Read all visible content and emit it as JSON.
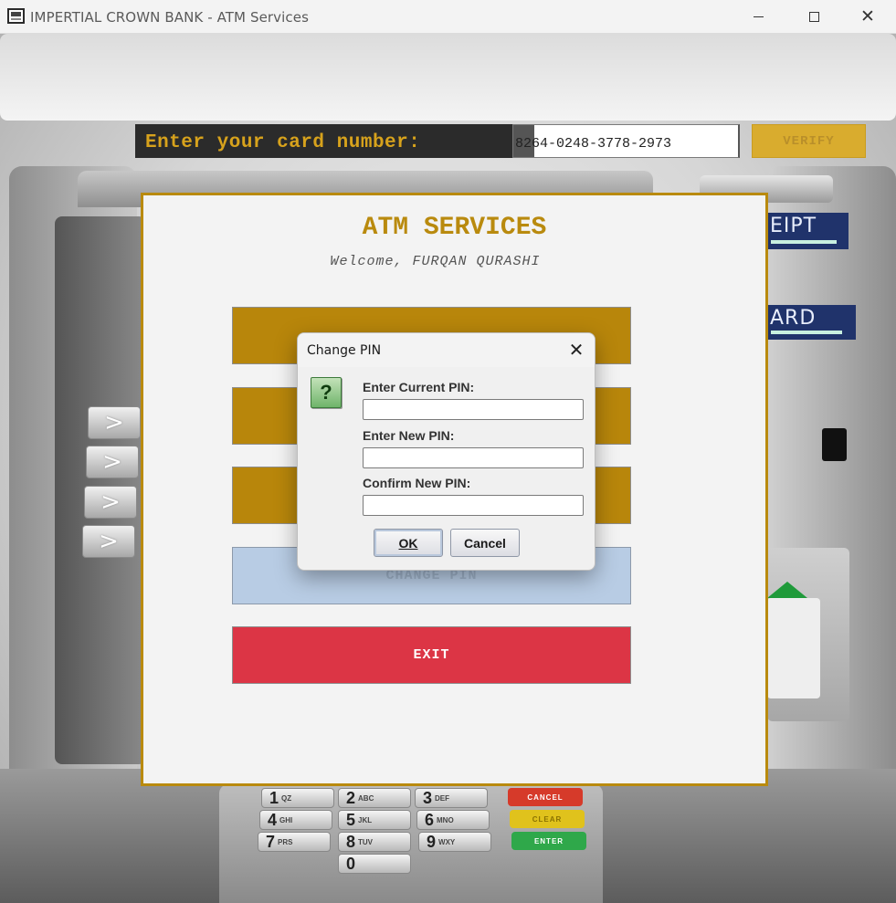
{
  "window": {
    "title": "IMPERTIAL CROWN BANK - ATM Services",
    "close_glyph": "✕"
  },
  "card_entry": {
    "prompt": "Enter your card number:",
    "card_number": "8264-0248-3778-2973",
    "verify_label": "VERIFY"
  },
  "atm_background": {
    "receipt_label": "EIPT",
    "card_label": "ARD",
    "side_key_glyph": ">",
    "keypad": {
      "digits": [
        {
          "digit": "1",
          "letters": "QZ"
        },
        {
          "digit": "2",
          "letters": "ABC"
        },
        {
          "digit": "3",
          "letters": "DEF"
        },
        {
          "digit": "4",
          "letters": "GHI"
        },
        {
          "digit": "5",
          "letters": "JKL"
        },
        {
          "digit": "6",
          "letters": "MNO"
        },
        {
          "digit": "7",
          "letters": "PRS"
        },
        {
          "digit": "8",
          "letters": "TUV"
        },
        {
          "digit": "9",
          "letters": "WXY"
        },
        {
          "digit": "0",
          "letters": ""
        }
      ],
      "function_keys": [
        {
          "label": "CANCEL",
          "color": "#d63a2a"
        },
        {
          "label": "CLEAR",
          "color": "#e0c21c"
        },
        {
          "label": "ENTER",
          "color": "#2fa84a"
        }
      ]
    }
  },
  "services": {
    "title": "ATM SERVICES",
    "welcome": "Welcome, FURQAN QURASHI",
    "buttons": [
      {
        "label": "",
        "style": "gold"
      },
      {
        "label": "",
        "style": "gold"
      },
      {
        "label": "",
        "style": "gold"
      },
      {
        "label": "CHANGE PIN",
        "style": "selected"
      },
      {
        "label": "EXIT",
        "style": "danger"
      }
    ]
  },
  "dialog": {
    "title": "Change PIN",
    "close_glyph": "✕",
    "icon_glyph": "?",
    "fields": [
      {
        "label": "Enter Current PIN:",
        "value": ""
      },
      {
        "label": "Enter New PIN:",
        "value": ""
      },
      {
        "label": "Confirm New PIN:",
        "value": ""
      }
    ],
    "ok_label": "OK",
    "cancel_label": "Cancel"
  },
  "colors": {
    "brand_gold": "#b98a0e",
    "exit_red": "#dc3545",
    "selected_blue": "#b8cce4",
    "label_navy": "#20336b"
  }
}
